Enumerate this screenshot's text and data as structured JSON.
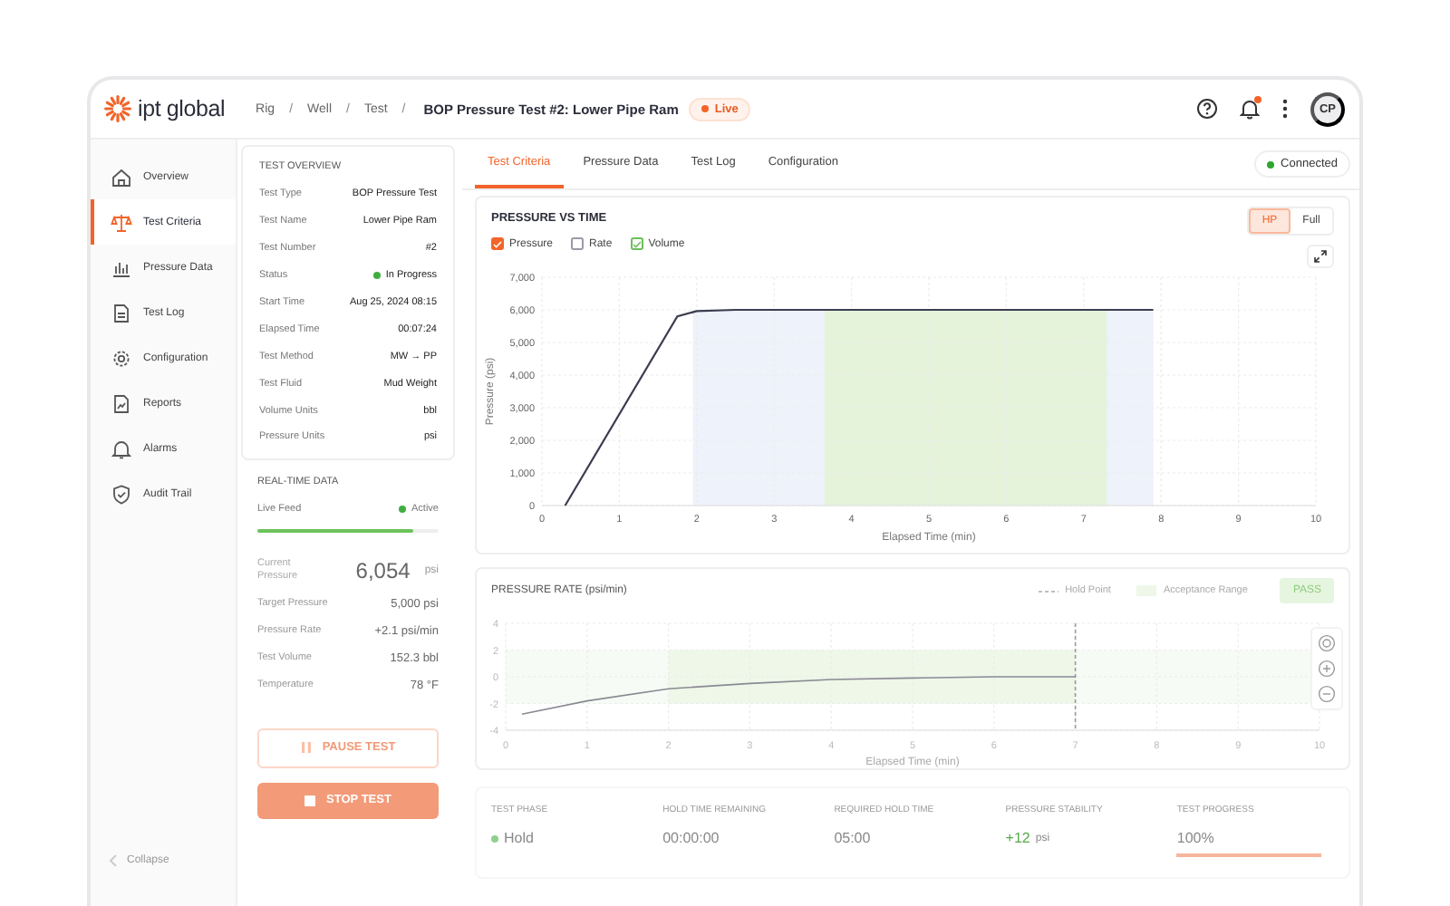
{
  "header": {
    "logo_text": "ipt global",
    "breadcrumb": [
      {
        "label": "Rig",
        "separator": "/"
      },
      {
        "label": "Well",
        "separator": "/"
      },
      {
        "label": "Test",
        "separator": "/"
      }
    ],
    "title": "BOP Pressure Test #2: Lower Pipe Ram",
    "live_badge": "Live",
    "notification_dot": true,
    "avatar": "CP"
  },
  "sidebar": {
    "items": [
      {
        "label": "Overview",
        "selected": false
      },
      {
        "label": "Test Criteria",
        "selected": true
      },
      {
        "label": "Pressure Data",
        "selected": false
      },
      {
        "label": "Test Log",
        "selected": false
      },
      {
        "label": "Configuration",
        "selected": false
      },
      {
        "label": "Reports",
        "selected": false
      },
      {
        "label": "Alarms",
        "selected": false
      },
      {
        "label": "Audit Trail",
        "selected": false
      }
    ],
    "collapse": "Collapse"
  },
  "test_overview": {
    "title": "TEST OVERVIEW",
    "rows": [
      {
        "label": "Test Type",
        "value": "BOP Pressure Test"
      },
      {
        "label": "Test Name",
        "value": "Lower Pipe Ram"
      },
      {
        "label": "Test Number",
        "value": "#2"
      },
      {
        "label": "Status",
        "value": "In Progress",
        "color": "#3fae3f"
      },
      {
        "label": "Start Time",
        "value": "Aug 25, 2024 08:15"
      },
      {
        "label": "Elapsed Time",
        "value": "00:07:24"
      },
      {
        "label": "Test Method",
        "value": "MW → PP"
      },
      {
        "label": "Test Fluid",
        "value": "Mud Weight"
      },
      {
        "label": "Volume Units",
        "value": "bbl"
      },
      {
        "label": "Pressure Units",
        "value": "psi"
      }
    ]
  },
  "real_time_data": {
    "title": "REAL-TIME DATA",
    "live_feed": {
      "label": "Live Feed",
      "value": "Active",
      "level": 0.86
    },
    "current_pressure": {
      "label": "Current Pressure",
      "value": "6,054",
      "unit": "psi"
    },
    "rows": [
      {
        "label": "Target Pressure",
        "value": "5,000 psi"
      },
      {
        "label": "Pressure Rate",
        "value": "+2.1 psi/min"
      },
      {
        "label": "Test Volume",
        "value": "152.3 bbl"
      },
      {
        "label": "Temperature",
        "value": "78 °F"
      }
    ]
  },
  "buttons": [
    {
      "kind": "pause",
      "label": "PAUSE TEST"
    },
    {
      "kind": "stop",
      "label": "STOP TEST"
    }
  ],
  "tabs": [
    {
      "label": "Test Criteria",
      "selected": true
    },
    {
      "label": "Pressure Data",
      "selected": false
    },
    {
      "label": "Test Log",
      "selected": false
    },
    {
      "label": "Configuration",
      "selected": false
    }
  ],
  "connection": {
    "label": "Connected",
    "color": "#2fa52f"
  },
  "pressure_chart": {
    "toggles": [
      {
        "label": "Pressure",
        "checked": true,
        "color": "#f2642a"
      },
      {
        "label": "Rate",
        "checked": false,
        "color": "#9a9aa6"
      },
      {
        "label": "Volume",
        "checked": true,
        "color": "#6cbf5a"
      }
    ],
    "range_options": [
      {
        "label": "HP",
        "selected": true
      },
      {
        "label": "Full",
        "selected": false
      }
    ],
    "chart_data": {
      "type": "line",
      "title": "PRESSURE VS TIME",
      "xlabel": "Elapsed Time (min)",
      "ylabel": "Pressure (psi)",
      "x": [
        0.3,
        1.75,
        2,
        2.5,
        7.9
      ],
      "series": [
        {
          "color": "#3b3d50",
          "values": [
            0,
            5800,
            5960,
            6000,
            6000
          ]
        }
      ],
      "grid": true,
      "xlim": [
        0,
        10
      ],
      "ylim": [
        0,
        7000
      ],
      "xticks": [
        0,
        1,
        2,
        3,
        4,
        5,
        6,
        7,
        8,
        9,
        10
      ],
      "yticks": [
        {
          "value": 0,
          "label": "0"
        },
        {
          "value": 1000,
          "label": "1,000"
        },
        {
          "value": 2000,
          "label": "2,000"
        },
        {
          "value": 3000,
          "label": "3,000"
        },
        {
          "value": 4000,
          "label": "4,000"
        },
        {
          "value": 5000,
          "label": "5,000"
        },
        {
          "value": 6000,
          "label": "6,000"
        },
        {
          "value": 7000,
          "label": "7,000"
        }
      ],
      "bands": [
        {
          "axis": "x",
          "from": 1.95,
          "to": 7.9,
          "color": "#eef2fb"
        },
        {
          "axis": "x",
          "from": 3.65,
          "to": 7.3,
          "color": "#e4f3da"
        }
      ]
    }
  },
  "rate_chart": {
    "legend": [
      {
        "kind": "dashed",
        "label": "Hold Point"
      },
      {
        "kind": "band",
        "label": "Acceptance Range"
      }
    ],
    "result": "PASS",
    "chart_data": {
      "type": "line",
      "title": "PRESSURE RATE (psi/min)",
      "xlabel": "Elapsed Time (min)",
      "x": [
        0.2,
        1,
        2,
        3,
        4,
        5,
        6,
        7
      ],
      "series": [
        {
          "color": "#8a8a94",
          "values": [
            -2.8,
            -1.8,
            -0.9,
            -0.5,
            -0.2,
            -0.1,
            0,
            0
          ]
        }
      ],
      "grid": true,
      "xlim": [
        0,
        10
      ],
      "ylim": [
        -4,
        4
      ],
      "xticks": [
        0,
        1,
        2,
        3,
        4,
        5,
        6,
        7,
        8,
        9,
        10
      ],
      "yticks": [
        -4,
        -2,
        0,
        2,
        4
      ],
      "bands": [
        {
          "axis": "x",
          "from": 2,
          "to": 7,
          "color": "#eef7e8"
        },
        {
          "axis": "y",
          "from": -2,
          "to": 2,
          "color": "#f7fbf5"
        }
      ],
      "ref_lines": [
        {
          "axis": "x",
          "value": 7,
          "color": "#9a9aa0"
        }
      ]
    }
  },
  "stats": [
    {
      "label": "TEST PHASE",
      "value": "Hold",
      "color": "#8fd08f"
    },
    {
      "label": "HOLD TIME REMAINING",
      "value": "00:00:00"
    },
    {
      "label": "REQUIRED HOLD TIME",
      "value": "05:00"
    },
    {
      "label": "PRESSURE STABILITY",
      "value": "+12",
      "unit": "psi"
    },
    {
      "label": "TEST PROGRESS",
      "value": "100%",
      "level": 1
    }
  ]
}
